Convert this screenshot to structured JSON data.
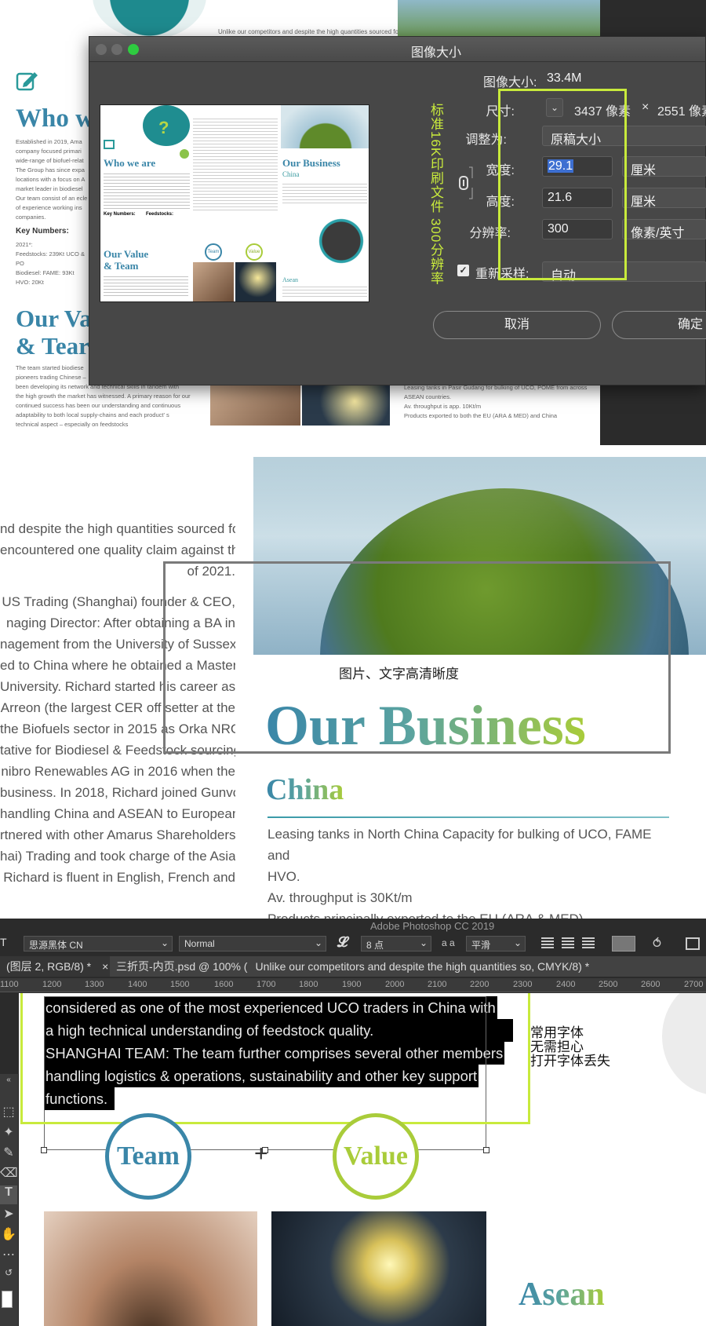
{
  "panel1": {
    "bg_snippet": "Unlike our competitors and despite the high quantities sourced for",
    "heading_who": "Who w",
    "body_lines": [
      "Established in 2019, Ama",
      "company focused primari",
      "wide-range of biofuel-relat",
      "The Group has since expa",
      "locations with a focus on A",
      "market leader in biodiesel",
      "Our team consist of an ecle",
      "of experience working ins",
      "companies."
    ],
    "key_numbers": "Key Numbers:",
    "kn_lines": [
      "2021*:",
      "Feedstocks: 239Kt UCO & PO",
      "Biodiesel: FAME: 93Kt",
      "HVO: 20Kt"
    ],
    "heading_value": "Our Va",
    "heading_team": "& Tear",
    "team_lines": [
      "The team started biodiese",
      "pioneers trading Chinese –",
      "been developing its network and technical skills in tandem with",
      "the high growth the market has witnessed. A primary reason for our",
      "continued success has been our understanding and continuous",
      "adaptability to both local supply-chains and each product' s",
      "technical aspect – especially on feedstocks"
    ],
    "right_lines": [
      "Leasing tanks in Pasir Gudang for bulking of UCO, POME from across",
      "ASEAN countries.",
      "Av. throughput is app. 10Kt/m",
      "Products exported to both the EU (ARA & MED) and China"
    ]
  },
  "dialog": {
    "title": "图像大小",
    "image_size_label": "图像大小:",
    "image_size_value": "33.4M",
    "dimensions_label": "尺寸:",
    "dimensions_width": "3437 像素",
    "dimensions_x": "×",
    "dimensions_height": "2551 像素",
    "fit_label": "调整为:",
    "fit_value": "原稿大小",
    "width_label": "宽度:",
    "width_value": "29.1",
    "width_unit": "厘米",
    "height_label": "高度:",
    "height_value": "21.6",
    "height_unit": "厘米",
    "resolution_label": "分辨率:",
    "resolution_value": "300",
    "resolution_unit": "像素/英寸",
    "resample_label": "重新采样:",
    "resample_value": "自动",
    "cancel_label": "取消",
    "ok_label": "确定",
    "annotation": "标准16K印刷文件 300分辨率",
    "preview": {
      "who": "Who we are",
      "business": "Our Business",
      "china": "China",
      "value": "Our Value",
      "team": "& Team",
      "asean": "Asean",
      "key_numbers": "Key Numbers:",
      "feedstocks": "Feedstocks:",
      "team_badge": "Team",
      "value_badge": "Value",
      "question": "?"
    }
  },
  "panel2": {
    "left_lines": [
      "nd despite the high quantities sourced for",
      "encountered one quality claim against the",
      "of 2021.",
      "US Trading (Shanghai) founder & CEO,",
      "naging Director: After obtaining a BA in",
      "nagement from the University of Sussex,",
      "ed to China where he obtained a Master",
      "University. Richard started his career as",
      "Arreon (the largest CER off setter at the",
      "the Biofuels sector in 2015 as Orka NRG",
      "tative for Biodiesel & Feedstock sourcing",
      "nibro Renewables AG in 2016 when the",
      "business. In 2018, Richard joined Gunvor",
      "handling China and ASEAN to European",
      "rtnered with other Amarus Shareholders",
      "hai) Trading and took charge of the Asian",
      "Richard is fluent in English, French and"
    ],
    "annotation": "图片、文字高清晰度",
    "heading": "Our Business",
    "subheading": "China",
    "body": [
      "Leasing tanks  in North China Capacity for bulking of UCO, FAME and",
      "HVO.",
      "Av. throughput is 30Kt/m",
      "Products principally exported to the EU (ARA & MED)"
    ]
  },
  "panel3": {
    "app_title": "Adobe Photoshop CC 2019",
    "font_family": "思源黑体 CN",
    "font_style": "Normal",
    "font_size": "8 点",
    "aa_label": "a a",
    "antialias": "平滑",
    "tab1": "(图层 2, RGB/8) *",
    "tab2": "三折页-内页.psd @ 100% (",
    "tab2_layer": "Unlike our competitors and despite the high quantities so, CMYK/8) *",
    "ruler": [
      "1100",
      "1200",
      "1300",
      "1400",
      "1500",
      "1600",
      "1700",
      "1800",
      "1900",
      "2000",
      "2100",
      "2200",
      "2300",
      "2400",
      "2500",
      "2600",
      "2700"
    ],
    "selected_text": [
      "considered as one of the most experienced UCO traders in China with",
      "a high technical understanding of feedstock quality.",
      "SHANGHAI TEAM: The team further comprises several other members",
      "handling logistics & operations, sustainability and other key support",
      "functions."
    ],
    "annotation": [
      "常用字体",
      "无需担心",
      "打开字体丢失"
    ],
    "team_badge": "Team",
    "value_badge": "Value",
    "plus": "+",
    "asean": "Asean"
  },
  "colors": {
    "accent_green": "#c8ea3c",
    "teal": "#3a86a8",
    "lime": "#a9cc3a",
    "dialog_bg": "#474747",
    "ps_bg": "#2b2b2b"
  }
}
